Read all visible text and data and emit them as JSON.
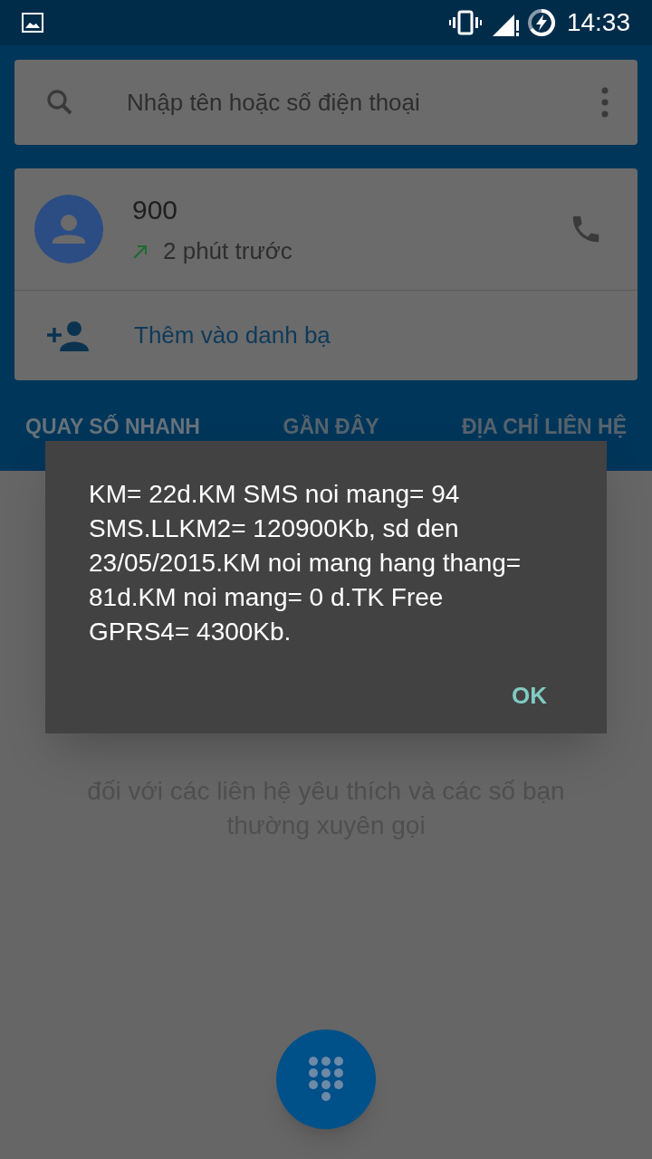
{
  "status_bar": {
    "time": "14:33"
  },
  "search": {
    "placeholder": "Nhập tên hoặc số điện thoại"
  },
  "recent_call": {
    "number": "900",
    "time": "2 phút trước"
  },
  "add_contact": {
    "label": "Thêm vào danh bạ"
  },
  "tabs": [
    {
      "label": "QUAY SỐ NHANH",
      "selected": true
    },
    {
      "label": "GẦN ĐÂY",
      "selected": false
    },
    {
      "label": "ĐỊA CHỈ LIÊN HỆ",
      "selected": false
    }
  ],
  "empty_hint": "đối với các liên hệ yêu thích và các số bạn thường xuyên gọi",
  "dialog": {
    "message": "KM= 22d.KM SMS noi mang= 94 SMS.LLKM2= 120900Kb, sd den 23/05/2015.KM noi mang hang thang= 81d.KM noi mang= 0 d.TK Free GPRS4= 4300Kb.",
    "button": "OK"
  }
}
